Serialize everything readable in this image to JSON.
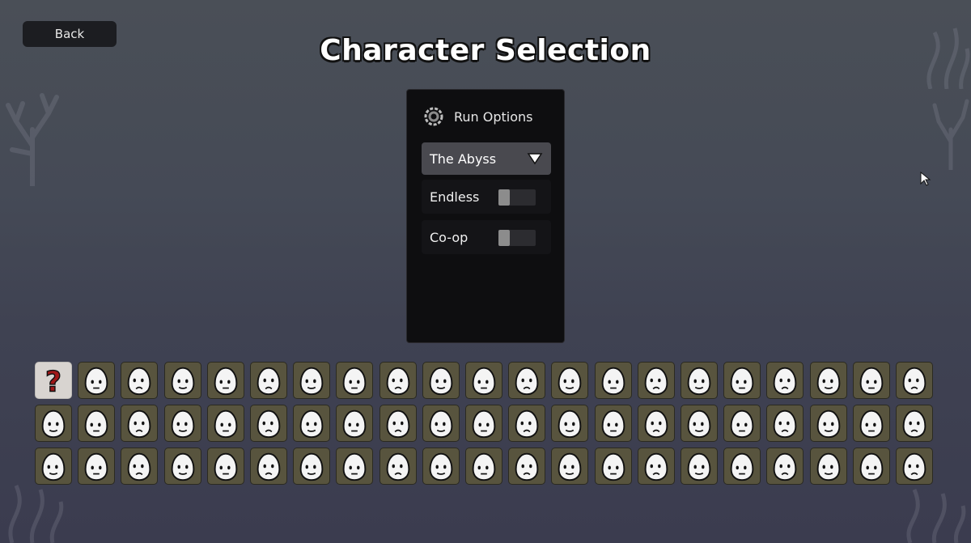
{
  "back_label": "Back",
  "title": "Character Selection",
  "run_options": {
    "header": "Run Options",
    "selected_mode": "The Abyss",
    "endless_label": "Endless",
    "endless_enabled": false,
    "coop_label": "Co-op",
    "coop_enabled": false
  },
  "random_character_label": "?",
  "character_rows": [
    [
      "random",
      "smug",
      "eyepatch",
      "sleepy",
      "monocle",
      "goblet",
      "calm",
      "grumpy",
      "dots",
      "freckled",
      "bandaged",
      "shout",
      "cheerful",
      "sad",
      "wink",
      "glasses",
      "plain",
      "gruff",
      "bearded-small",
      "scared",
      "lollipop"
    ],
    [
      "hooded",
      "knight",
      "bearded",
      "goggles",
      "ninja",
      "grin",
      "shades",
      "scarf",
      "viking",
      "calm2",
      "crying",
      "feathered",
      "wavy",
      "bird",
      "cap",
      "stone",
      "crown",
      "leafy",
      "calm3",
      "spiky",
      "visor"
    ],
    [
      "angry",
      "mustache",
      "panda",
      "clown",
      "bandana",
      "robot",
      "tongue",
      "fedora",
      "kiss",
      "hardhat",
      "beard-goatee",
      "mask",
      "calm4",
      "antlers",
      "bearded-big",
      "tophat",
      "diver",
      "beanie",
      "wrapped",
      "whistle",
      "pipe"
    ]
  ],
  "colors": {
    "tile": "#58543e",
    "tile_random": "#d8d4d0",
    "panel": "#0e0e10",
    "dropdown": "#49494f",
    "question": "#a01818"
  }
}
